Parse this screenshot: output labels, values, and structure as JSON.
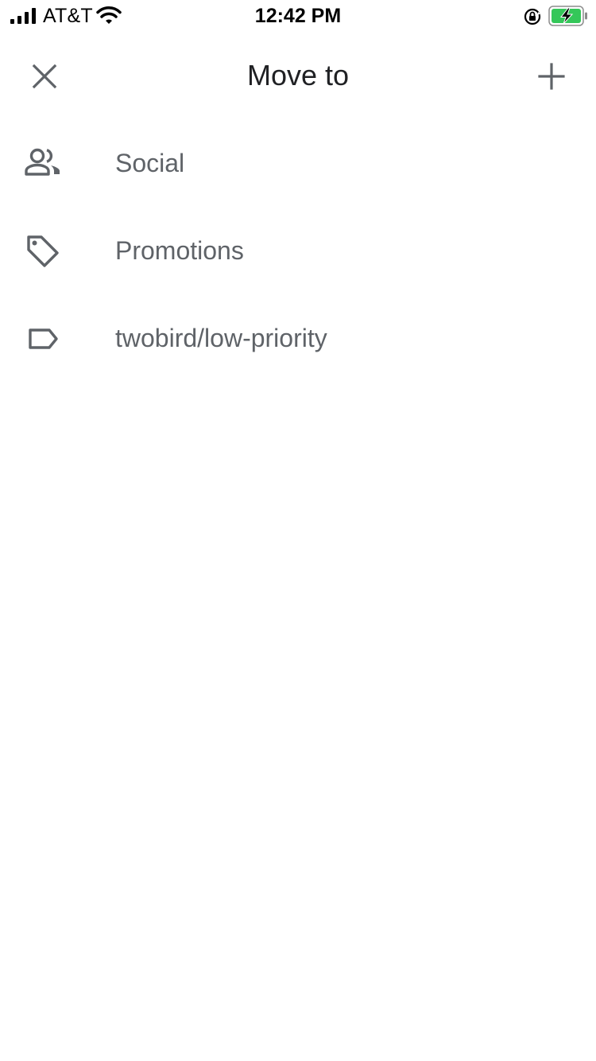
{
  "status_bar": {
    "carrier": "AT&T",
    "time": "12:42 PM",
    "signal_icon": "signal-bars-icon",
    "wifi_icon": "wifi-icon",
    "rotation_lock_icon": "rotation-lock-icon",
    "battery_icon": "battery-charging-icon",
    "battery_color": "#34c759"
  },
  "header": {
    "title": "Move to",
    "close_icon": "close-icon",
    "add_icon": "plus-icon"
  },
  "labels": [
    {
      "label": "Social",
      "icon": "people-icon"
    },
    {
      "label": "Promotions",
      "icon": "tag-icon"
    },
    {
      "label": "twobird/low-priority",
      "icon": "label-outline-icon"
    }
  ],
  "colors": {
    "icon_gray": "#5f6368",
    "title_text": "#202124",
    "background": "#ffffff"
  }
}
